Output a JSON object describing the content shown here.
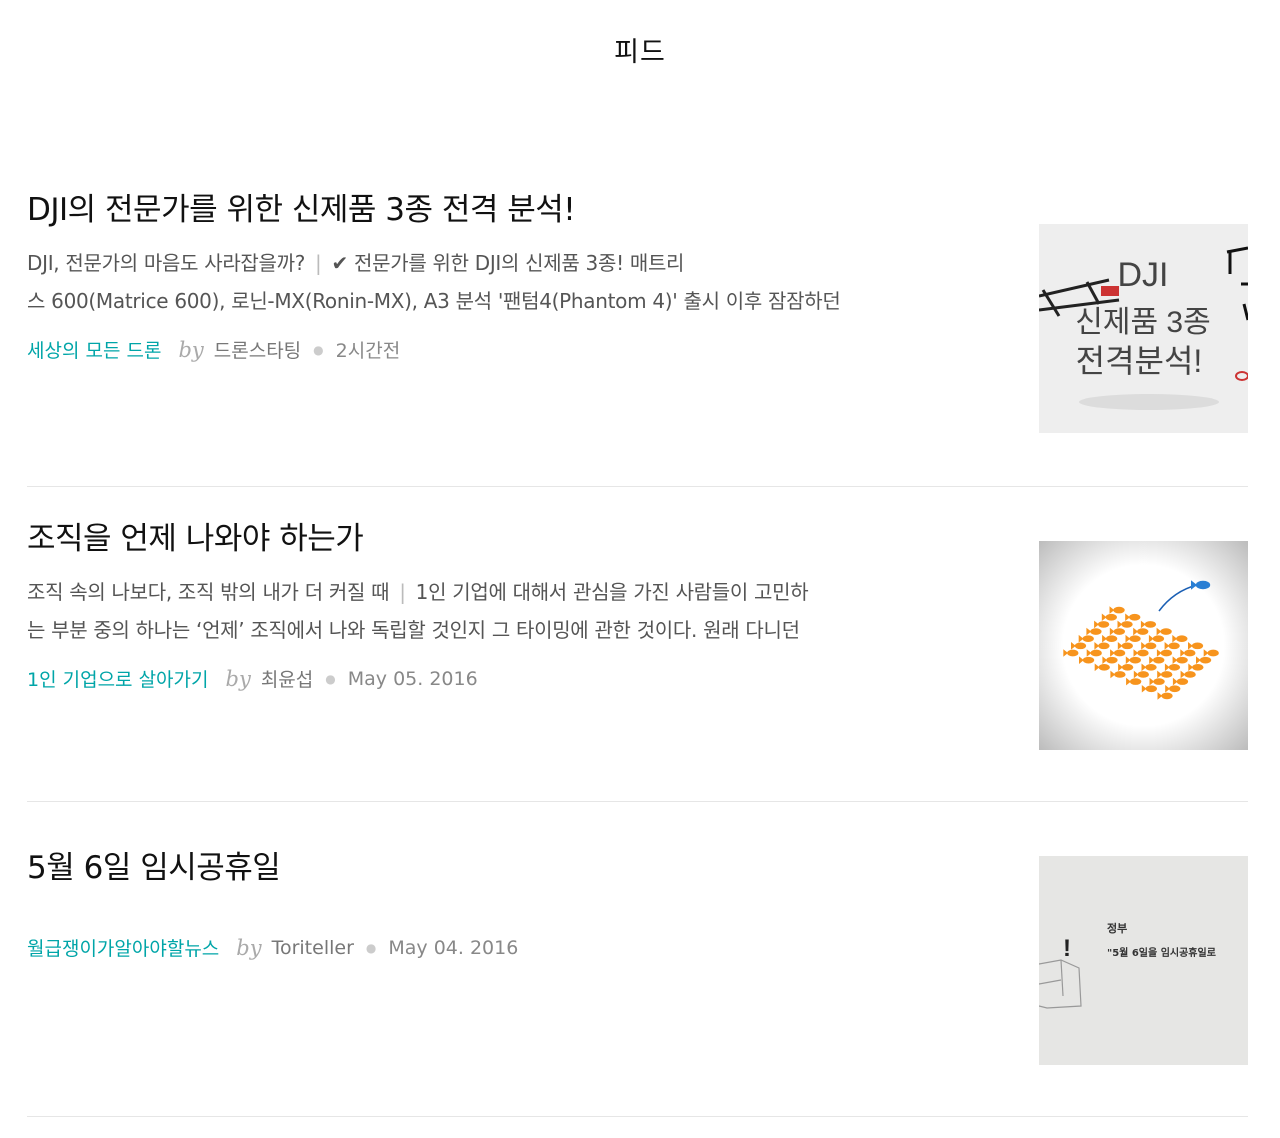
{
  "header": {
    "title": "피드"
  },
  "articles": [
    {
      "title": "DJI의 전문가를 위한 신제품 3종 전격 분석!",
      "subtitle": "DJI, 전문가의 마음도 사라잡을까?",
      "excerpt_line1": "✔ 전문가를 위한 DJI의 신제품 3종! 매트리",
      "excerpt_line2": "스 600(Matrice 600), 로닌-MX(Ronin-MX), A3 분석 '팬텀4(Phantom 4)' 출시 이후 잠잠하던",
      "magazine": "세상의 모든 드론",
      "by": "by",
      "author": "드론스타팅",
      "time": "2시간전",
      "thumb": {
        "line1": "DJI",
        "line2": "신제품 3종",
        "line3": "전격분석!"
      }
    },
    {
      "title": "조직을 언제 나와야 하는가",
      "subtitle": "조직 속의 나보다, 조직 밖의 내가 더 커질 때",
      "excerpt_line1": "1인 기업에 대해서 관심을 가진 사람들이 고민하",
      "excerpt_line2": "는 부분 중의 하나는 ‘언제’ 조직에서 나와 독립할 것인지 그 타이밍에 관한 것이다. 원래 다니던",
      "magazine": "1인 기업으로 살아가기",
      "by": "by",
      "author": "최윤섭",
      "time": "May 05. 2016"
    },
    {
      "title": "5월 6일 임시공휴일",
      "magazine": "월급쟁이가알아야할뉴스",
      "by": "by",
      "author": "Toriteller",
      "time": "May 04. 2016",
      "thumb": {
        "line1": "정부",
        "line2": "\"5월 6일을 임시공휴일로",
        "mark": "!"
      }
    }
  ],
  "colors": {
    "accent": "#00a5a8",
    "fish": "#f7941d",
    "fish_leader": "#2a7fd4"
  }
}
